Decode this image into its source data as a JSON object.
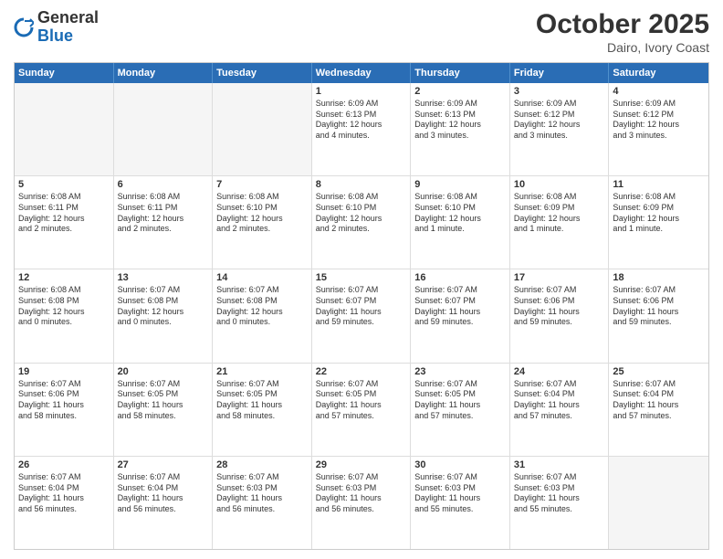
{
  "header": {
    "logo": {
      "general": "General",
      "blue": "Blue"
    },
    "title": "October 2025",
    "subtitle": "Dairo, Ivory Coast"
  },
  "calendar": {
    "days_of_week": [
      "Sunday",
      "Monday",
      "Tuesday",
      "Wednesday",
      "Thursday",
      "Friday",
      "Saturday"
    ],
    "rows": [
      {
        "cells": [
          {
            "day": "",
            "empty": true
          },
          {
            "day": "",
            "empty": true
          },
          {
            "day": "",
            "empty": true
          },
          {
            "day": "1",
            "lines": [
              "Sunrise: 6:09 AM",
              "Sunset: 6:13 PM",
              "Daylight: 12 hours",
              "and 4 minutes."
            ]
          },
          {
            "day": "2",
            "lines": [
              "Sunrise: 6:09 AM",
              "Sunset: 6:13 PM",
              "Daylight: 12 hours",
              "and 3 minutes."
            ]
          },
          {
            "day": "3",
            "lines": [
              "Sunrise: 6:09 AM",
              "Sunset: 6:12 PM",
              "Daylight: 12 hours",
              "and 3 minutes."
            ]
          },
          {
            "day": "4",
            "lines": [
              "Sunrise: 6:09 AM",
              "Sunset: 6:12 PM",
              "Daylight: 12 hours",
              "and 3 minutes."
            ]
          }
        ]
      },
      {
        "cells": [
          {
            "day": "5",
            "lines": [
              "Sunrise: 6:08 AM",
              "Sunset: 6:11 PM",
              "Daylight: 12 hours",
              "and 2 minutes."
            ]
          },
          {
            "day": "6",
            "lines": [
              "Sunrise: 6:08 AM",
              "Sunset: 6:11 PM",
              "Daylight: 12 hours",
              "and 2 minutes."
            ]
          },
          {
            "day": "7",
            "lines": [
              "Sunrise: 6:08 AM",
              "Sunset: 6:10 PM",
              "Daylight: 12 hours",
              "and 2 minutes."
            ]
          },
          {
            "day": "8",
            "lines": [
              "Sunrise: 6:08 AM",
              "Sunset: 6:10 PM",
              "Daylight: 12 hours",
              "and 2 minutes."
            ]
          },
          {
            "day": "9",
            "lines": [
              "Sunrise: 6:08 AM",
              "Sunset: 6:10 PM",
              "Daylight: 12 hours",
              "and 1 minute."
            ]
          },
          {
            "day": "10",
            "lines": [
              "Sunrise: 6:08 AM",
              "Sunset: 6:09 PM",
              "Daylight: 12 hours",
              "and 1 minute."
            ]
          },
          {
            "day": "11",
            "lines": [
              "Sunrise: 6:08 AM",
              "Sunset: 6:09 PM",
              "Daylight: 12 hours",
              "and 1 minute."
            ]
          }
        ]
      },
      {
        "cells": [
          {
            "day": "12",
            "lines": [
              "Sunrise: 6:08 AM",
              "Sunset: 6:08 PM",
              "Daylight: 12 hours",
              "and 0 minutes."
            ]
          },
          {
            "day": "13",
            "lines": [
              "Sunrise: 6:07 AM",
              "Sunset: 6:08 PM",
              "Daylight: 12 hours",
              "and 0 minutes."
            ]
          },
          {
            "day": "14",
            "lines": [
              "Sunrise: 6:07 AM",
              "Sunset: 6:08 PM",
              "Daylight: 12 hours",
              "and 0 minutes."
            ]
          },
          {
            "day": "15",
            "lines": [
              "Sunrise: 6:07 AM",
              "Sunset: 6:07 PM",
              "Daylight: 11 hours",
              "and 59 minutes."
            ]
          },
          {
            "day": "16",
            "lines": [
              "Sunrise: 6:07 AM",
              "Sunset: 6:07 PM",
              "Daylight: 11 hours",
              "and 59 minutes."
            ]
          },
          {
            "day": "17",
            "lines": [
              "Sunrise: 6:07 AM",
              "Sunset: 6:06 PM",
              "Daylight: 11 hours",
              "and 59 minutes."
            ]
          },
          {
            "day": "18",
            "lines": [
              "Sunrise: 6:07 AM",
              "Sunset: 6:06 PM",
              "Daylight: 11 hours",
              "and 59 minutes."
            ]
          }
        ]
      },
      {
        "cells": [
          {
            "day": "19",
            "lines": [
              "Sunrise: 6:07 AM",
              "Sunset: 6:06 PM",
              "Daylight: 11 hours",
              "and 58 minutes."
            ]
          },
          {
            "day": "20",
            "lines": [
              "Sunrise: 6:07 AM",
              "Sunset: 6:05 PM",
              "Daylight: 11 hours",
              "and 58 minutes."
            ]
          },
          {
            "day": "21",
            "lines": [
              "Sunrise: 6:07 AM",
              "Sunset: 6:05 PM",
              "Daylight: 11 hours",
              "and 58 minutes."
            ]
          },
          {
            "day": "22",
            "lines": [
              "Sunrise: 6:07 AM",
              "Sunset: 6:05 PM",
              "Daylight: 11 hours",
              "and 57 minutes."
            ]
          },
          {
            "day": "23",
            "lines": [
              "Sunrise: 6:07 AM",
              "Sunset: 6:05 PM",
              "Daylight: 11 hours",
              "and 57 minutes."
            ]
          },
          {
            "day": "24",
            "lines": [
              "Sunrise: 6:07 AM",
              "Sunset: 6:04 PM",
              "Daylight: 11 hours",
              "and 57 minutes."
            ]
          },
          {
            "day": "25",
            "lines": [
              "Sunrise: 6:07 AM",
              "Sunset: 6:04 PM",
              "Daylight: 11 hours",
              "and 57 minutes."
            ]
          }
        ]
      },
      {
        "cells": [
          {
            "day": "26",
            "lines": [
              "Sunrise: 6:07 AM",
              "Sunset: 6:04 PM",
              "Daylight: 11 hours",
              "and 56 minutes."
            ]
          },
          {
            "day": "27",
            "lines": [
              "Sunrise: 6:07 AM",
              "Sunset: 6:04 PM",
              "Daylight: 11 hours",
              "and 56 minutes."
            ]
          },
          {
            "day": "28",
            "lines": [
              "Sunrise: 6:07 AM",
              "Sunset: 6:03 PM",
              "Daylight: 11 hours",
              "and 56 minutes."
            ]
          },
          {
            "day": "29",
            "lines": [
              "Sunrise: 6:07 AM",
              "Sunset: 6:03 PM",
              "Daylight: 11 hours",
              "and 56 minutes."
            ]
          },
          {
            "day": "30",
            "lines": [
              "Sunrise: 6:07 AM",
              "Sunset: 6:03 PM",
              "Daylight: 11 hours",
              "and 55 minutes."
            ]
          },
          {
            "day": "31",
            "lines": [
              "Sunrise: 6:07 AM",
              "Sunset: 6:03 PM",
              "Daylight: 11 hours",
              "and 55 minutes."
            ]
          },
          {
            "day": "",
            "empty": true
          }
        ]
      }
    ]
  }
}
